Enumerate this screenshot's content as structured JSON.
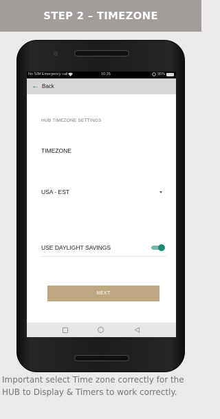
{
  "banner": {
    "title": "STEP 2 – TIMEZONE"
  },
  "status_bar": {
    "left": "No SIM  Emergency call",
    "time": "10:35",
    "battery": "95%"
  },
  "header": {
    "back_label": "Back"
  },
  "form": {
    "section_title": "HUB TIMEZONE SETTINGS",
    "timezone_label": "TIMEZONE",
    "timezone_value": "USA - EST",
    "daylight_label": "USE DAYLIGHT SAVINGS",
    "daylight_enabled": true,
    "next_label": "NEXT"
  },
  "colors": {
    "accent": "#1d8a70",
    "button": "#bea881",
    "banner": "#a09d9b"
  },
  "caption": "Important select Time zone correctly for the HUB to Display & Timers to work correctly."
}
